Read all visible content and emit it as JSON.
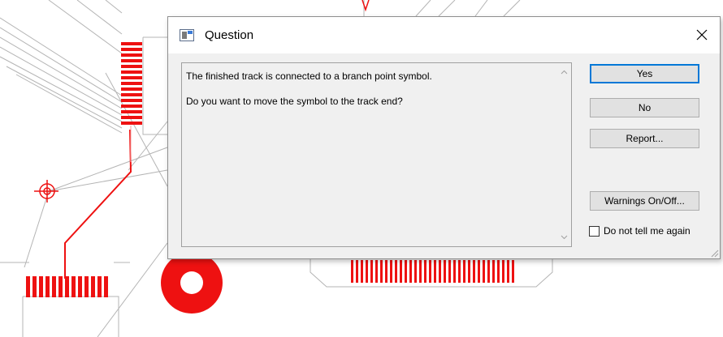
{
  "dialog": {
    "title": "Question",
    "message_lines": [
      "The finished track is connected to a branch point symbol.",
      "Do you want to move the symbol to the track end?"
    ],
    "buttons": {
      "yes": "Yes",
      "no": "No",
      "report": "Report...",
      "warnings": "Warnings On/Off..."
    },
    "checkbox_label": "Do not tell me again",
    "checkbox_checked": false
  },
  "colors": {
    "pcb_red": "#ee1111",
    "pcb_gray": "#b4b4b4",
    "dialog_bg": "#f0f0f0",
    "default_button_border": "#0078d7"
  }
}
